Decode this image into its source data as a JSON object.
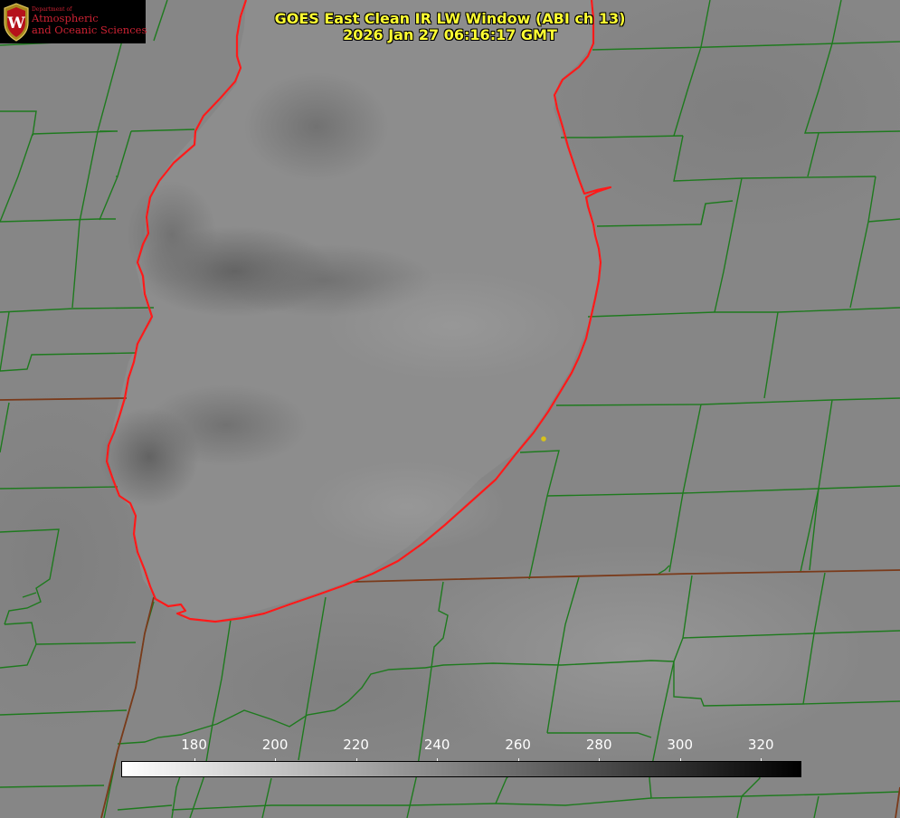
{
  "title": {
    "line1": "GOES East Clean IR LW Window (ABI ch 13)",
    "line2": "2026 Jan 27 06:16:17 GMT"
  },
  "logo": {
    "department": "Department of",
    "name_line1": "Atmospheric",
    "name_line2": "and Oceanic Sciences",
    "crest_icon": "uw-crest-icon",
    "crest_letter": "W",
    "color": "#cc2233"
  },
  "colorbar": {
    "unit_scale": "brightness temperature (K)",
    "min_value": 162,
    "max_value": 330,
    "min_color": "#ffffff",
    "max_color": "#000000",
    "tick_labels": [
      "180",
      "200",
      "220",
      "240",
      "260",
      "280",
      "300",
      "320"
    ],
    "tick_values": [
      180,
      200,
      220,
      240,
      260,
      280,
      300,
      320
    ]
  },
  "map": {
    "background_color": "#858585",
    "county_line_color": "#1e7a1e",
    "state_line_color": "#7a3a1a",
    "lake_outline_color": "#ff1a1a",
    "marker_color": "#d8c21a"
  }
}
